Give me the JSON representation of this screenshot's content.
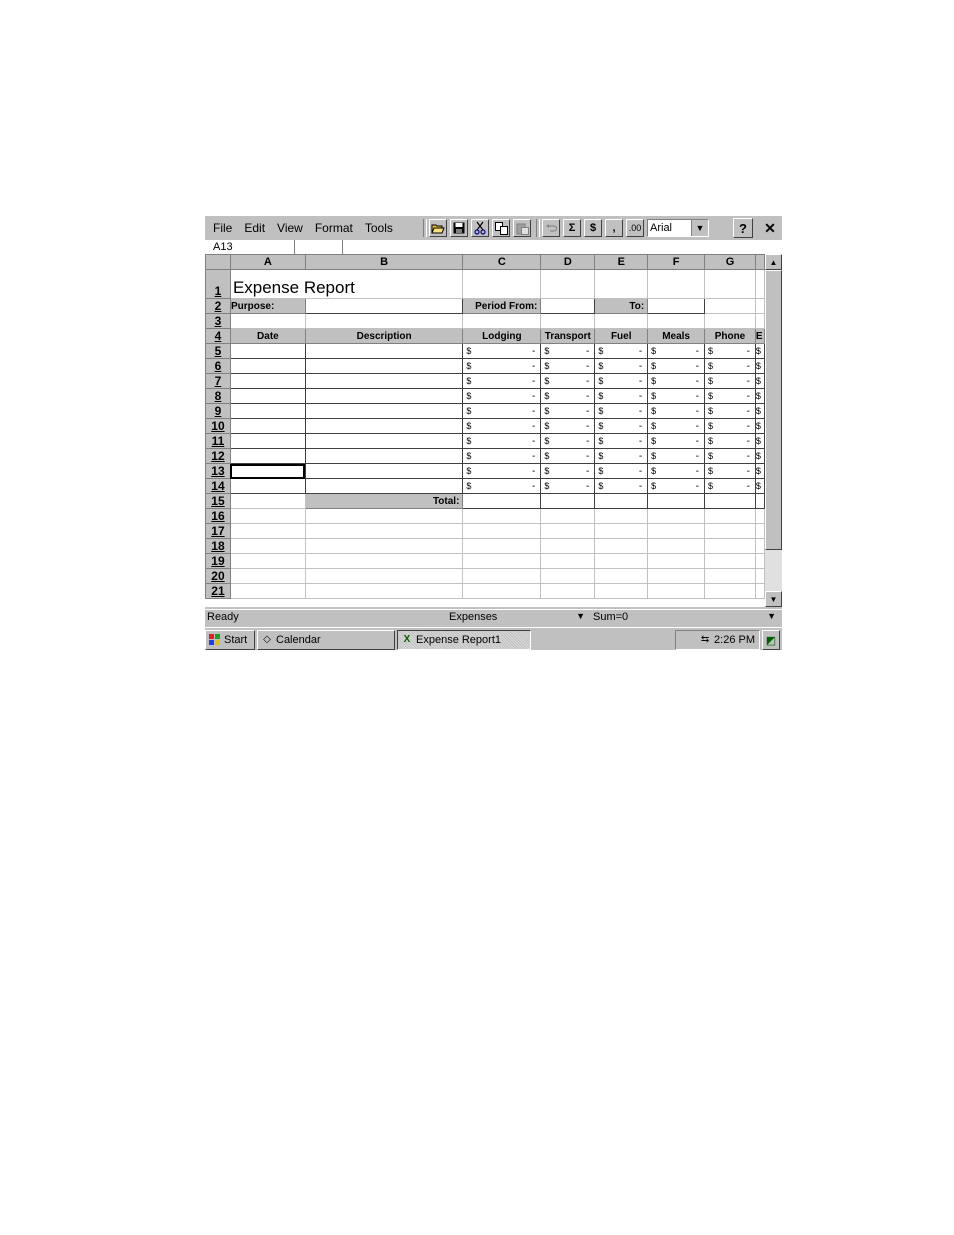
{
  "menu": [
    "File",
    "Edit",
    "View",
    "Format",
    "Tools"
  ],
  "toolbar": {
    "font": "Arial",
    "sum_symbol": "Σ",
    "currency_symbol": "$",
    "comma_symbol": ",",
    "decimal_symbol": ".00",
    "help_symbol": "?",
    "close_symbol": "✕"
  },
  "name_box": "A13",
  "columns": [
    "A",
    "B",
    "C",
    "D",
    "E",
    "F",
    "G"
  ],
  "sheet": {
    "title": "Expense Report",
    "purpose_label": "Purpose:",
    "period_from_label": "Period From:",
    "to_label": "To:",
    "headers": {
      "date": "Date",
      "description": "Description",
      "lodging": "Lodging",
      "transport": "Transport",
      "fuel": "Fuel",
      "meals": "Meals",
      "phone": "Phone",
      "next_partial": "E"
    },
    "total_label": "Total:",
    "currency_symbol": "$",
    "empty_amount": "-",
    "rows": [
      "1",
      "2",
      "3",
      "4",
      "5",
      "6",
      "7",
      "8",
      "9",
      "10",
      "11",
      "12",
      "13",
      "14",
      "15",
      "16",
      "17",
      "18",
      "19",
      "20",
      "21"
    ]
  },
  "status": {
    "text": "Ready",
    "sheet": "Expenses",
    "sum": "Sum=0"
  },
  "taskbar": {
    "start": "Start",
    "calendar": "Calendar",
    "active_window": "Expense Report1",
    "time": "2:26 PM"
  }
}
